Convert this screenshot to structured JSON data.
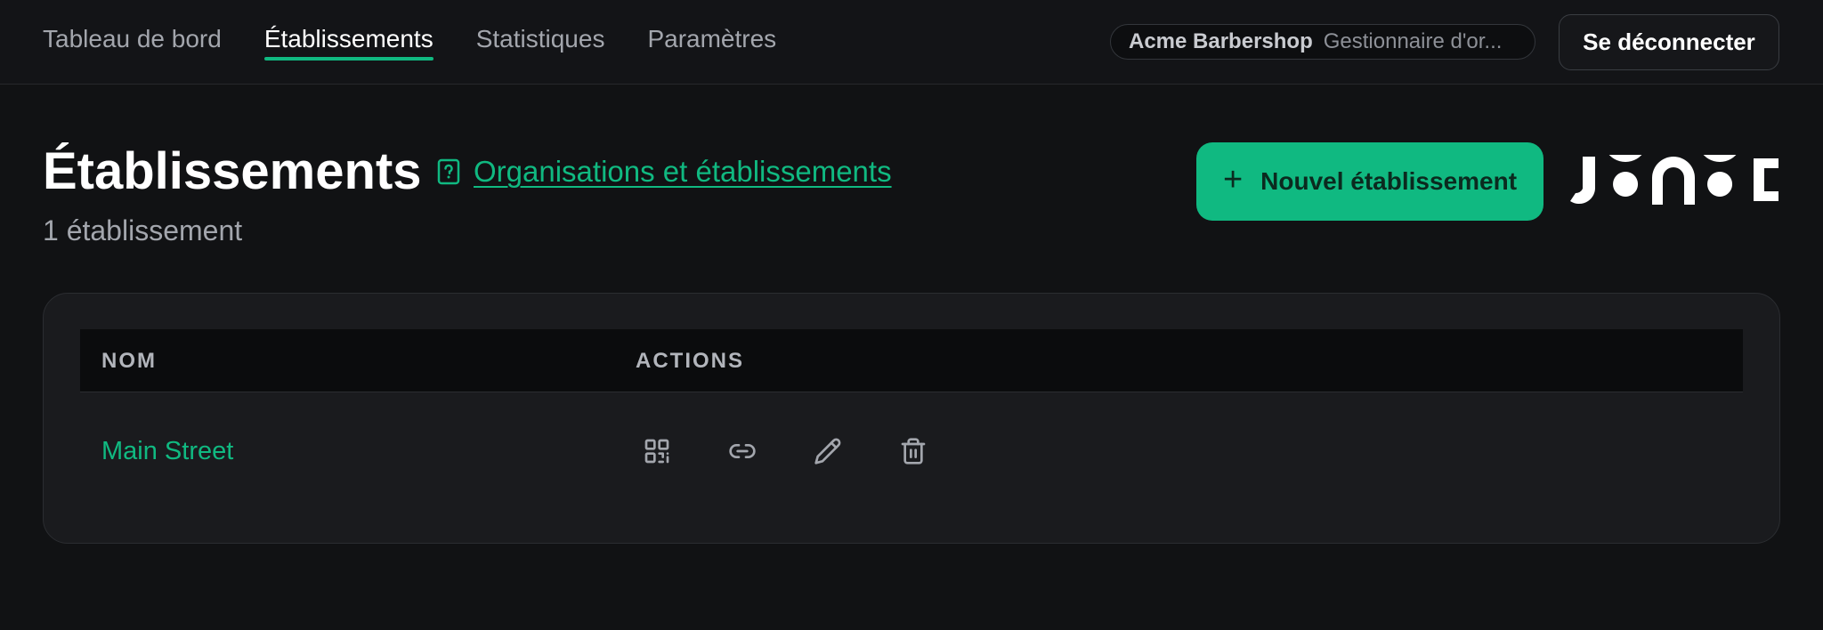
{
  "nav": {
    "items": [
      {
        "label": "Tableau de bord",
        "active": false
      },
      {
        "label": "Établissements",
        "active": true
      },
      {
        "label": "Statistiques",
        "active": false
      },
      {
        "label": "Paramètres",
        "active": false
      }
    ]
  },
  "account": {
    "org_name": "Acme Barbershop",
    "role": "Gestionnaire d'or...",
    "logout_label": "Se déconnecter"
  },
  "header": {
    "title": "Établissements",
    "doc_link": "Organisations et établissements",
    "subtitle": "1 établissement",
    "new_button": "Nouvel établissement",
    "new_button_icon": "plus-icon",
    "logo_alt": "brand-logo"
  },
  "table": {
    "columns": [
      "NOM",
      "ACTIONS"
    ],
    "rows": [
      {
        "name": "Main Street",
        "actions": [
          "qr-code-icon",
          "link-icon",
          "pencil-icon",
          "trash-icon"
        ]
      }
    ]
  },
  "colors": {
    "accent": "#10b981",
    "background": "#111214",
    "card": "#1a1b1e"
  }
}
